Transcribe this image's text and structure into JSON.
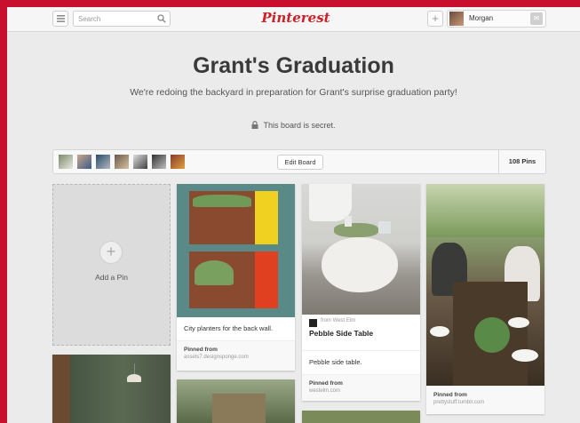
{
  "header": {
    "search_placeholder": "Search",
    "logo": "Pinterest",
    "user_name": "Morgan"
  },
  "board": {
    "title": "Grant's Graduation",
    "description": "We're redoing the backyard in preparation for Grant's surprise graduation party!",
    "secret_text": "This board is secret.",
    "edit_label": "Edit Board",
    "pins_count": "108 Pins"
  },
  "add_pin_label": "Add a Pin",
  "pins": [
    {
      "caption": "City planters for the back wall.",
      "pinned_from": "Pinned from",
      "source": "assets7.designsponge.com"
    },
    {
      "via": "from West Elm",
      "title": "Pebble Side Table",
      "caption": "Pebble side table.",
      "pinned_from": "Pinned from",
      "source": "westelm.com"
    },
    {
      "pinned_from": "Pinned from",
      "source": "prettystuff.tumblr.com"
    }
  ],
  "colors": {
    "brand": "#cb2027",
    "background": "#ebebeb"
  }
}
